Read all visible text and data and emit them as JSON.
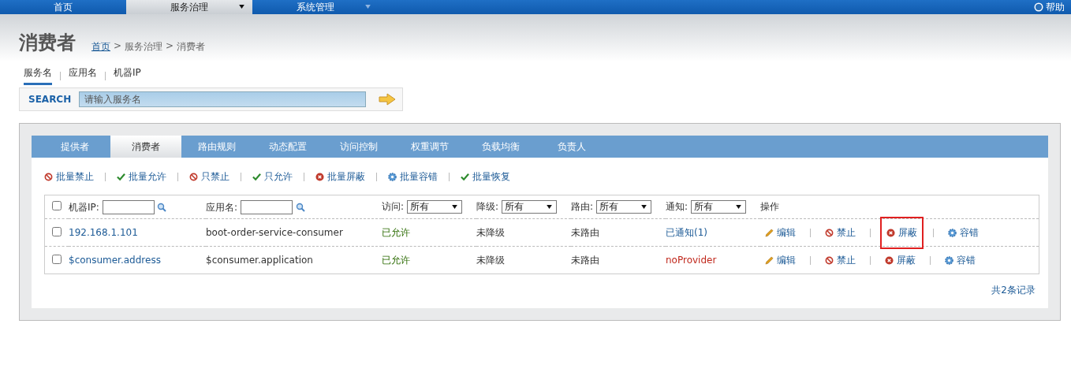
{
  "nav": {
    "items": [
      {
        "label": "首页",
        "selected": false,
        "dropdown": false
      },
      {
        "label": "服务治理",
        "selected": true,
        "dropdown": true
      },
      {
        "label": "系统管理",
        "selected": false,
        "dropdown": true
      }
    ],
    "help": "帮助"
  },
  "page": {
    "title": "消费者",
    "breadcrumb": [
      {
        "label": "首页",
        "kind": "link"
      },
      {
        "label": ">",
        "kind": "separator"
      },
      {
        "label": "服务治理",
        "kind": "text"
      },
      {
        "label": ">",
        "kind": "separator"
      },
      {
        "label": "消费者",
        "kind": "text"
      }
    ]
  },
  "search_tabs": [
    {
      "label": "服务名",
      "selected": true
    },
    {
      "label": "应用名",
      "selected": false
    },
    {
      "label": "机器IP",
      "selected": false
    }
  ],
  "search": {
    "label": "SEARCH",
    "placeholder": "请输入服务名"
  },
  "tabs": [
    {
      "label": "提供者",
      "selected": false
    },
    {
      "label": "消费者",
      "selected": true
    },
    {
      "label": "路由规则",
      "selected": false
    },
    {
      "label": "动态配置",
      "selected": false
    },
    {
      "label": "访问控制",
      "selected": false
    },
    {
      "label": "权重调节",
      "selected": false
    },
    {
      "label": "负载均衡",
      "selected": false
    },
    {
      "label": "负责人",
      "selected": false
    }
  ],
  "toolbar": [
    {
      "label": "批量禁止",
      "kind": "forbid"
    },
    {
      "label": "批量允许",
      "kind": "allow"
    },
    {
      "label": "只禁止",
      "kind": "forbid"
    },
    {
      "label": "只允许",
      "kind": "allow"
    },
    {
      "label": "批量屏蔽",
      "kind": "shield"
    },
    {
      "label": "批量容错",
      "kind": "tolerate"
    },
    {
      "label": "批量恢复",
      "kind": "allow"
    }
  ],
  "table": {
    "checked": false,
    "filters": [
      {
        "label": "机器IP:",
        "kind": "text"
      },
      {
        "label": "应用名:",
        "kind": "text"
      },
      {
        "label": "访问:",
        "kind": "select",
        "value": "所有"
      },
      {
        "label": "降级:",
        "kind": "select",
        "value": "所有"
      },
      {
        "label": "路由:",
        "kind": "select",
        "value": "所有"
      },
      {
        "label": "通知:",
        "kind": "select",
        "value": "所有"
      },
      {
        "label": "操作",
        "kind": "label"
      }
    ],
    "rows": [
      {
        "checked": false,
        "ip": "192.168.1.101",
        "application": "boot-order-service-consumer",
        "access": "已允许",
        "degrade": "未降级",
        "route": "未路由",
        "notify": {
          "text": "已通知(1)",
          "color": "#1c5a96"
        },
        "actions": [
          {
            "label": "编辑",
            "kind": "edit",
            "highlighted": false
          },
          {
            "label": "禁止",
            "kind": "forbid",
            "highlighted": false
          },
          {
            "label": "屏蔽",
            "kind": "shield",
            "highlighted": true
          },
          {
            "label": "容错",
            "kind": "tolerate",
            "highlighted": false
          }
        ]
      },
      {
        "checked": false,
        "ip": "$consumer.address",
        "application": "$consumer.application",
        "access": "已允许",
        "degrade": "未降级",
        "route": "未路由",
        "notify": {
          "text": "noProvider",
          "color": "#c0281c"
        },
        "actions": [
          {
            "label": "编辑",
            "kind": "edit",
            "highlighted": false
          },
          {
            "label": "禁止",
            "kind": "forbid",
            "highlighted": false
          },
          {
            "label": "屏蔽",
            "kind": "shield",
            "highlighted": false
          },
          {
            "label": "容错",
            "kind": "tolerate",
            "highlighted": false
          }
        ]
      }
    ],
    "footer": "共2条记录"
  }
}
